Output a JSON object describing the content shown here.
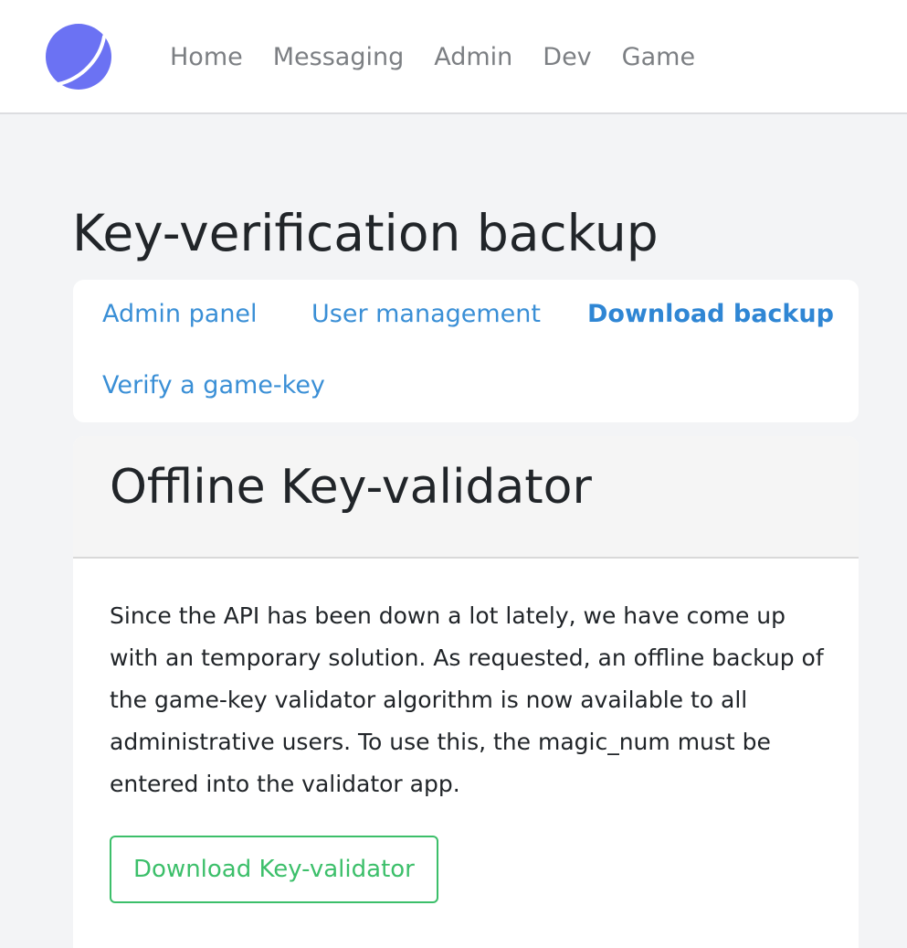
{
  "brand": {
    "logo_icon": "planet-logo-icon",
    "logo_color": "#6b72f3"
  },
  "nav": {
    "items": [
      {
        "label": "Home"
      },
      {
        "label": "Messaging"
      },
      {
        "label": "Admin"
      },
      {
        "label": "Dev"
      },
      {
        "label": "Game"
      }
    ]
  },
  "page": {
    "title": "Key-verification backup"
  },
  "subnav": {
    "items": [
      {
        "label": "Admin panel",
        "active": false
      },
      {
        "label": "User management",
        "active": false
      },
      {
        "label": "Download backup",
        "active": true
      },
      {
        "label": "Verify a game-key",
        "active": false
      }
    ]
  },
  "card": {
    "title": "Offline Key-validator",
    "body": "Since the API has been down a lot lately, we have come up with an temporary solution. As requested, an offline backup of the game-key validator algorithm is now available to all administrative users. To use this, the magic_num must be entered into the validator app.",
    "button_label": "Download Key-validator"
  },
  "colors": {
    "link": "#3a8fd6",
    "button": "#3cbf6a",
    "nav_text": "#7c7f83"
  }
}
